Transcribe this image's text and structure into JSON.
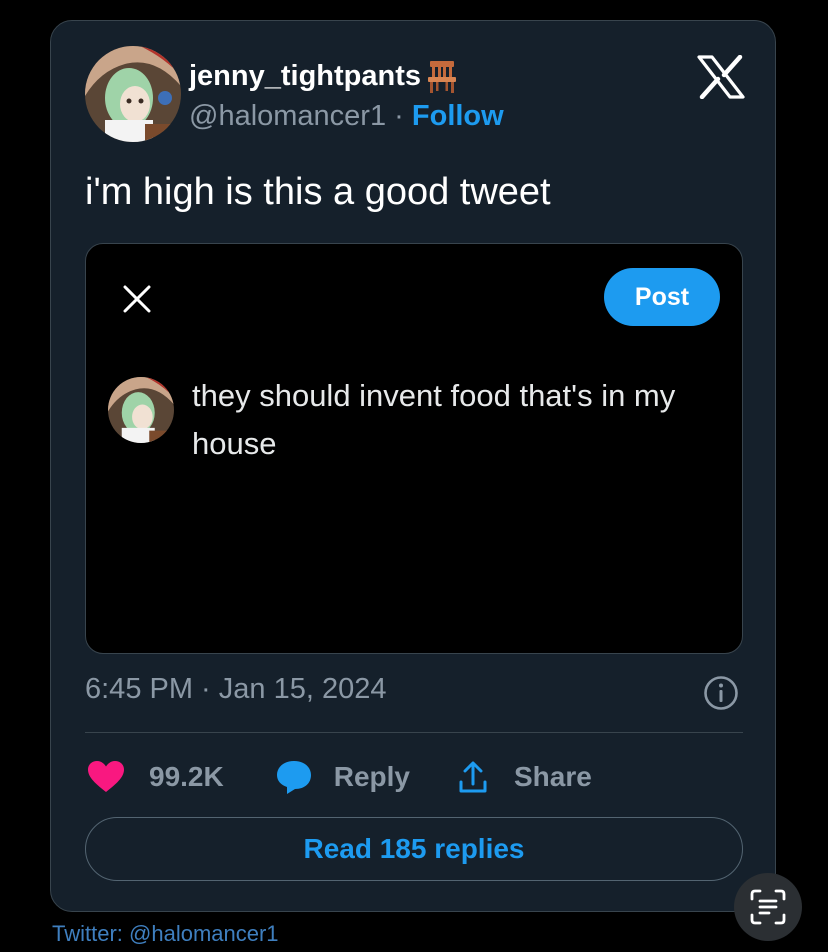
{
  "tweet": {
    "display_name": "jenny_tightpants",
    "handle": "@halomancer1",
    "separator": " · ",
    "follow_label": "Follow",
    "text": "i'm high is this a good tweet",
    "timestamp": "6:45 PM · Jan 15, 2024",
    "likes": "99.2K",
    "reply_label": "Reply",
    "share_label": "Share",
    "read_replies_label": "Read 185 replies"
  },
  "embedded_post": {
    "post_button_label": "Post",
    "text": "they should invent food that's in my house"
  },
  "footer": {
    "credit": "Twitter: @halomancer1"
  },
  "icons": {
    "name_emoji": "chair-icon",
    "brand": "x-logo-icon",
    "close": "close-icon",
    "info": "info-icon",
    "like": "heart-icon",
    "reply": "speech-bubble-icon",
    "share": "share-upload-icon",
    "scan": "text-scan-icon"
  },
  "colors": {
    "background": "#000000",
    "card": "#15202b",
    "accent": "#1d9bf0",
    "heart": "#f91880",
    "muted_text": "#8b98a5"
  }
}
